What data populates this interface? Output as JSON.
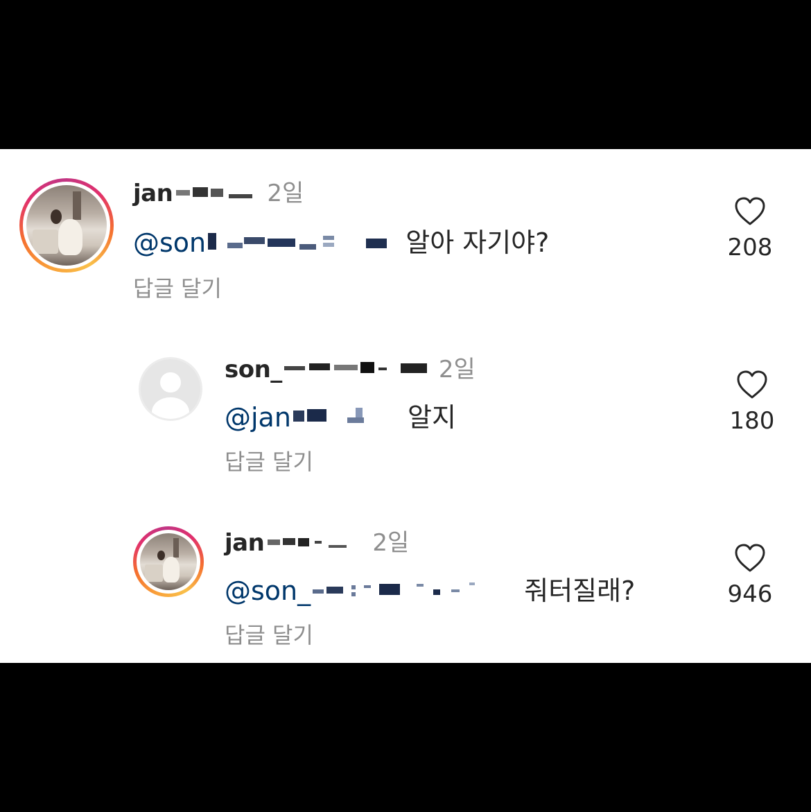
{
  "comments": [
    {
      "username": "jan",
      "time": "2일",
      "mention": "@son",
      "text": "알아 자기야?",
      "reply_label": "답글 달기",
      "likes": "208",
      "avatar": "photo-avatar"
    },
    {
      "username": "son_",
      "time": "2일",
      "mention": "@jan",
      "text": "알지",
      "reply_label": "답글 달기",
      "likes": "180",
      "avatar": "default-avatar"
    },
    {
      "username": "jan",
      "time": "2일",
      "mention": "@son_",
      "text": "줘터질래?",
      "reply_label": "답글 달기",
      "likes": "946",
      "avatar": "photo-avatar"
    }
  ],
  "icons": {
    "like": "heart-outline-icon"
  },
  "colors": {
    "mention": "#00376b",
    "muted": "#8e8e8e",
    "text": "#262626"
  }
}
